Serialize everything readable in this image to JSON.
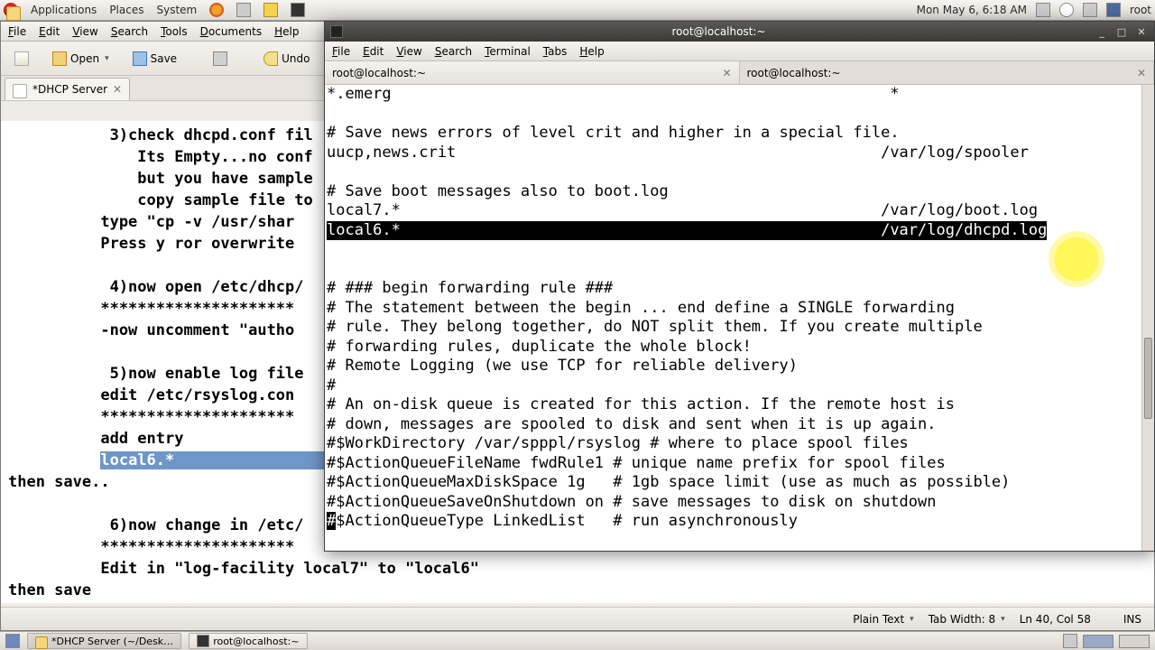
{
  "panel": {
    "menus": {
      "applications": "Applications",
      "places": "Places",
      "system": "System"
    },
    "clock": "Mon May  6,  6:18 AM",
    "user": "root"
  },
  "gedit": {
    "menubar": {
      "file": "File",
      "edit": "Edit",
      "view": "View",
      "search": "Search",
      "tools": "Tools",
      "documents": "Documents",
      "help": "Help"
    },
    "toolbar": {
      "open": "Open",
      "save": "Save",
      "undo": "Undo"
    },
    "tab": {
      "title": "*DHCP Server"
    },
    "text_pre": "           3)check dhcpd.conf fil\n              Its Empty...no conf\n              but you have sample\n              copy sample file to\n          type \"cp -v /usr/shar\n          Press y ror overwrite\n\n           4)now open /etc/dhcp/\n          *********************\n          -now uncomment \"autho\n\n           5)now enable log file\n          edit /etc/rsyslog.con\n          *********************\n          add entry\n          ",
    "sel": "local6.*                                   ",
    "text_post": "\nthen save..\n\n           6)now change in /etc/\n          *********************\n          Edit in \"log-facility local7\" to \"local6\"\nthen save",
    "status": {
      "plain": "Plain Text",
      "tabw": "Tab Width:  8",
      "lncol": "Ln 40, Col 58",
      "ins": "INS"
    }
  },
  "term": {
    "title": "root@localhost:~",
    "menubar": {
      "file": "File",
      "edit": "Edit",
      "view": "View",
      "search": "Search",
      "terminal": "Terminal",
      "tabs": "Tabs",
      "help": "Help"
    },
    "tabs": {
      "t1": "root@localhost:~",
      "t2": "root@localhost:~"
    },
    "body_pre": "*.emerg                                                      *\n\n# Save news errors of level crit and higher in a special file.\nuucp,news.crit                                              /var/log/spooler\n\n# Save boot messages also to boot.log\nlocal7.*                                                    /var/log/boot.log\n",
    "body_hl": "local6.*                                                    /var/log/dhcpd.log",
    "body_post": "\n\n\n# ### begin forwarding rule ###\n# The statement between the begin ... end define a SINGLE forwarding\n# rule. They belong together, do NOT split them. If you create multiple\n# forwarding rules, duplicate the whole block!\n# Remote Logging (we use TCP for reliable delivery)\n#\n# An on-disk queue is created for this action. If the remote host is\n# down, messages are spooled to disk and sent when it is up again.\n#$WorkDirectory /var/spppl/rsyslog # where to place spool files\n#$ActionQueueFileName fwdRule1 # unique name prefix for spool files\n#$ActionQueueMaxDiskSpace 1g   # 1gb space limit (use as much as possible)\n#$ActionQueueSaveOnShutdown on # save messages to disk on shutdown\n",
    "body_last_after_cursor": "$ActionQueueType LinkedList   # run asynchronously"
  },
  "taskbar": {
    "t1": "*DHCP Server (~/Desk…",
    "t2": "root@localhost:~"
  }
}
